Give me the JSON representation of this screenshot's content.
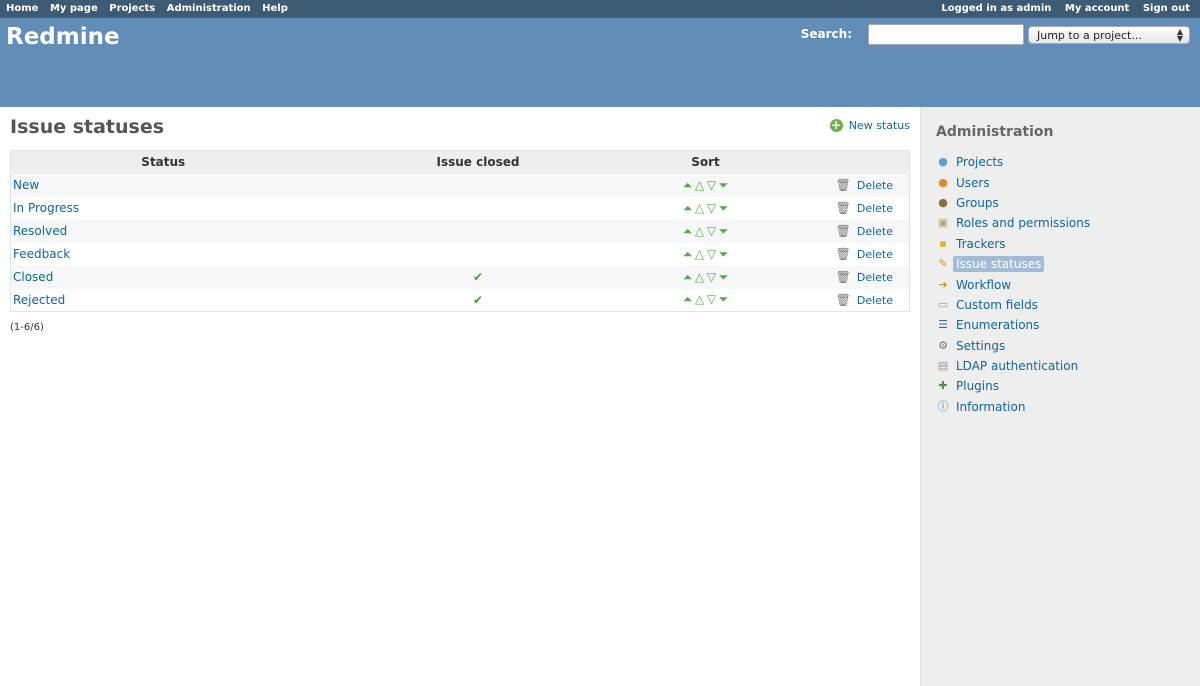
{
  "top_menu": {
    "left": [
      "Home",
      "My page",
      "Projects",
      "Administration",
      "Help"
    ],
    "logged_in": "Logged in as admin",
    "my_account": "My account",
    "sign_out": "Sign out"
  },
  "header": {
    "title": "Redmine",
    "search_label": "Search:",
    "search_value": "",
    "jump_label": "Jump to a project..."
  },
  "content": {
    "title": "Issue statuses",
    "new_status": "New status",
    "columns": [
      "Status",
      "Issue closed",
      "Sort",
      ""
    ],
    "rows": [
      {
        "name": "New",
        "closed": "",
        "delete": "Delete"
      },
      {
        "name": "In Progress",
        "closed": "",
        "delete": "Delete"
      },
      {
        "name": "Resolved",
        "closed": "",
        "delete": "Delete"
      },
      {
        "name": "Feedback",
        "closed": "",
        "delete": "Delete"
      },
      {
        "name": "Closed",
        "closed": "✔",
        "delete": "Delete"
      },
      {
        "name": "Rejected",
        "closed": "✔",
        "delete": "Delete"
      }
    ],
    "pagination": "(1-6/6)"
  },
  "sidebar": {
    "title": "Administration",
    "items": [
      {
        "label": "Projects",
        "icon": "projects-icon"
      },
      {
        "label": "Users",
        "icon": "user-icon"
      },
      {
        "label": "Groups",
        "icon": "group-icon"
      },
      {
        "label": "Roles and permissions",
        "icon": "roles-icon"
      },
      {
        "label": "Trackers",
        "icon": "tracker-icon"
      },
      {
        "label": "Issue statuses",
        "icon": "issue-status-icon"
      },
      {
        "label": "Workflow",
        "icon": "workflow-icon"
      },
      {
        "label": "Custom fields",
        "icon": "custom-fields-icon"
      },
      {
        "label": "Enumerations",
        "icon": "list-icon"
      },
      {
        "label": "Settings",
        "icon": "gear-icon"
      },
      {
        "label": "LDAP authentication",
        "icon": "server-key-icon"
      },
      {
        "label": "Plugins",
        "icon": "plugin-icon"
      },
      {
        "label": "Information",
        "icon": "info-icon"
      }
    ],
    "selected": "Issue statuses"
  },
  "colors": {
    "top_menu_bg": "#3e5b76",
    "header_bg": "#628db6",
    "link": "#169",
    "sidebar_bg": "#eeeeee"
  }
}
